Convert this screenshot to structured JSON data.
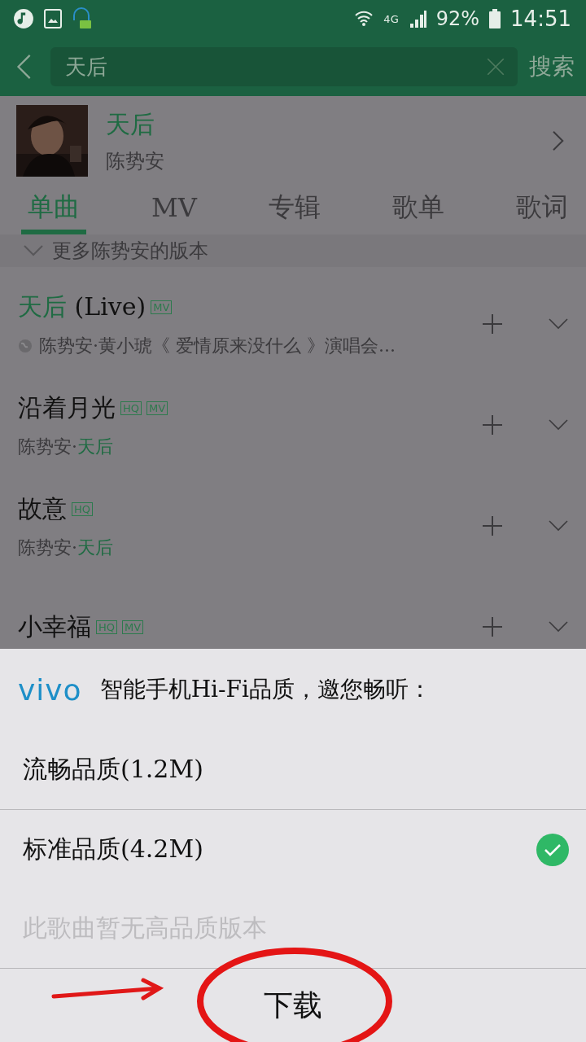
{
  "status_bar": {
    "network": "4G",
    "battery": "92%",
    "time": "14:51"
  },
  "search": {
    "value": "天后",
    "action": "搜索"
  },
  "artist": {
    "name": "天后",
    "singer": "陈势安"
  },
  "tabs": [
    {
      "label": "单曲",
      "selected": true
    },
    {
      "label": "MV",
      "selected": false
    },
    {
      "label": "专辑",
      "selected": false
    },
    {
      "label": "歌单",
      "selected": false
    },
    {
      "label": "歌词",
      "selected": false
    }
  ],
  "more_versions": "更多陈势安的版本",
  "songs": [
    {
      "title": [
        {
          "text": "天后",
          "match": true
        },
        {
          "text": " (Live)",
          "match": false
        }
      ],
      "tags": [
        "MV"
      ],
      "web": true,
      "subtitle": [
        {
          "text": "陈势安·黄小琥《 爱情原来没什么 》演唱会...",
          "match": false
        }
      ]
    },
    {
      "title": [
        {
          "text": "沿着月光",
          "match": false
        }
      ],
      "tags": [
        "HQ",
        "MV"
      ],
      "web": false,
      "subtitle": [
        {
          "text": "陈势安·",
          "match": false
        },
        {
          "text": "天后",
          "match": true
        }
      ]
    },
    {
      "title": [
        {
          "text": "故意",
          "match": false
        }
      ],
      "tags": [
        "HQ"
      ],
      "web": false,
      "subtitle": [
        {
          "text": "陈势安·",
          "match": false
        },
        {
          "text": "天后",
          "match": true
        }
      ]
    },
    {
      "title": [
        {
          "text": "小幸福",
          "match": false
        }
      ],
      "tags": [
        "HQ",
        "MV"
      ],
      "web": false
    }
  ],
  "sheet": {
    "brand": "vivo",
    "headline": "智能手机Hi-Fi品质，邀您畅听：",
    "options": [
      {
        "label": "流畅品质(1.2M)",
        "selected": false,
        "disabled": false
      },
      {
        "label": "标准品质(4.2M)",
        "selected": true,
        "disabled": false
      },
      {
        "label": "此歌曲暂无高品质版本",
        "selected": false,
        "disabled": true
      }
    ],
    "button": "下载"
  }
}
